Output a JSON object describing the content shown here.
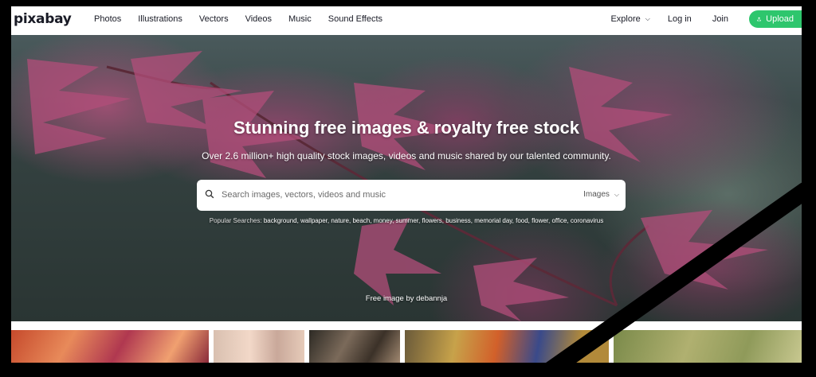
{
  "nav": {
    "logo": "pixabay",
    "menu": [
      "Photos",
      "Illustrations",
      "Vectors",
      "Videos",
      "Music",
      "Sound Effects"
    ],
    "explore": "Explore",
    "login": "Log in",
    "join": "Join",
    "upload": "Upload",
    "accent": "#2ec66d"
  },
  "hero": {
    "title": "Stunning free images & royalty free stock",
    "subtitle": "Over 2.6 million+ high quality stock images, videos and music shared by our talented community.",
    "search": {
      "placeholder": "Search images, vectors, videos and music",
      "type": "Images"
    },
    "popular_label": "Popular Searches:",
    "popular_terms": "background, wallpaper, nature, beach, money, summer, flowers, business, memorial day, food, flower, office, coronavirus",
    "credit": "Free image by debannja"
  },
  "icons": {
    "search": "search-icon",
    "upload": "upload-icon",
    "chevron": "chevron-down-icon"
  }
}
